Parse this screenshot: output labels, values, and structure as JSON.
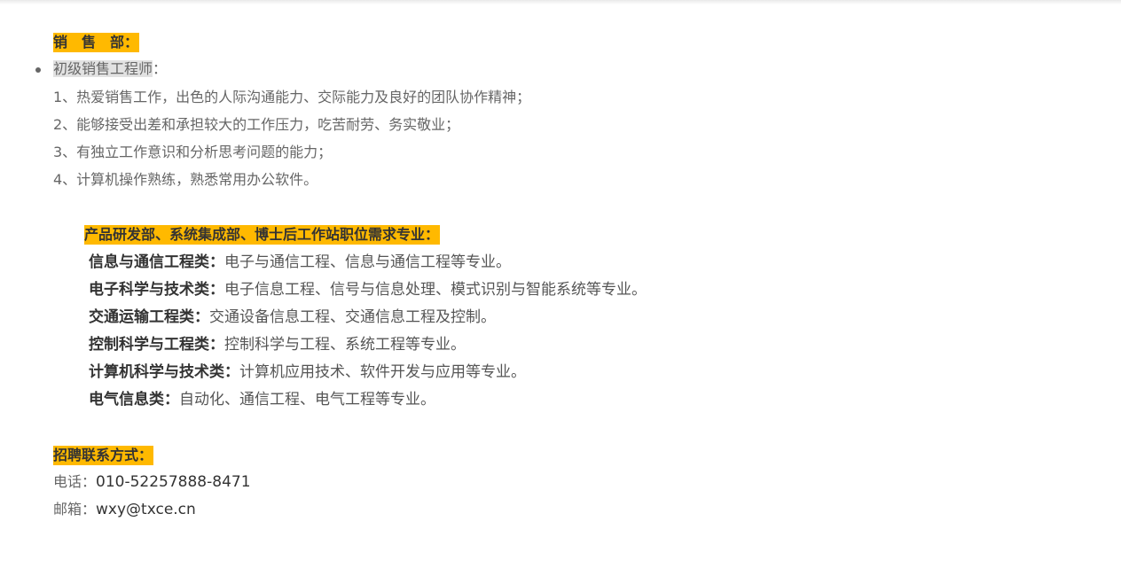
{
  "sales": {
    "heading": "销　售　部：",
    "position_title": "初级销售工程师",
    "position_suffix": "：",
    "requirements": [
      "1、热爱销售工作，出色的人际沟通能力、交际能力及良好的团队协作精神；",
      "2、能够接受出差和承担较大的工作压力，吃苦耐劳、务实敬业；",
      "3、有独立工作意识和分析思考问题的能力；",
      "4、计算机操作熟练，熟悉常用办公软件。"
    ]
  },
  "rd": {
    "heading": "产品研发部、系统集成部、博士后工作站职位需求专业：",
    "majors": [
      {
        "category": "信息与通信工程类：",
        "detail": "电子与通信工程、信息与通信工程等专业。"
      },
      {
        "category": "电子科学与技术类：",
        "detail": "电子信息工程、信号与信息处理、模式识别与智能系统等专业。"
      },
      {
        "category": "交通运输工程类：",
        "detail": "交通设备信息工程、交通信息工程及控制。"
      },
      {
        "category": "控制科学与工程类：",
        "detail": "控制科学与工程、系统工程等专业。"
      },
      {
        "category": "计算机科学与技术类：",
        "detail": "计算机应用技术、软件开发与应用等专业。"
      },
      {
        "category": "电气信息类：",
        "detail": "自动化、通信工程、电气工程等专业。"
      }
    ]
  },
  "contact": {
    "heading": "招聘联系方式：",
    "phone_label": "电话：",
    "phone_value": "010-52257888-8471",
    "email_label": "邮箱：",
    "email_value": "wxy@txce.cn"
  },
  "colors": {
    "highlight": "#ffb900",
    "gray_highlight": "#e2e2e2",
    "text": "#555555",
    "strong_text": "#333333"
  }
}
